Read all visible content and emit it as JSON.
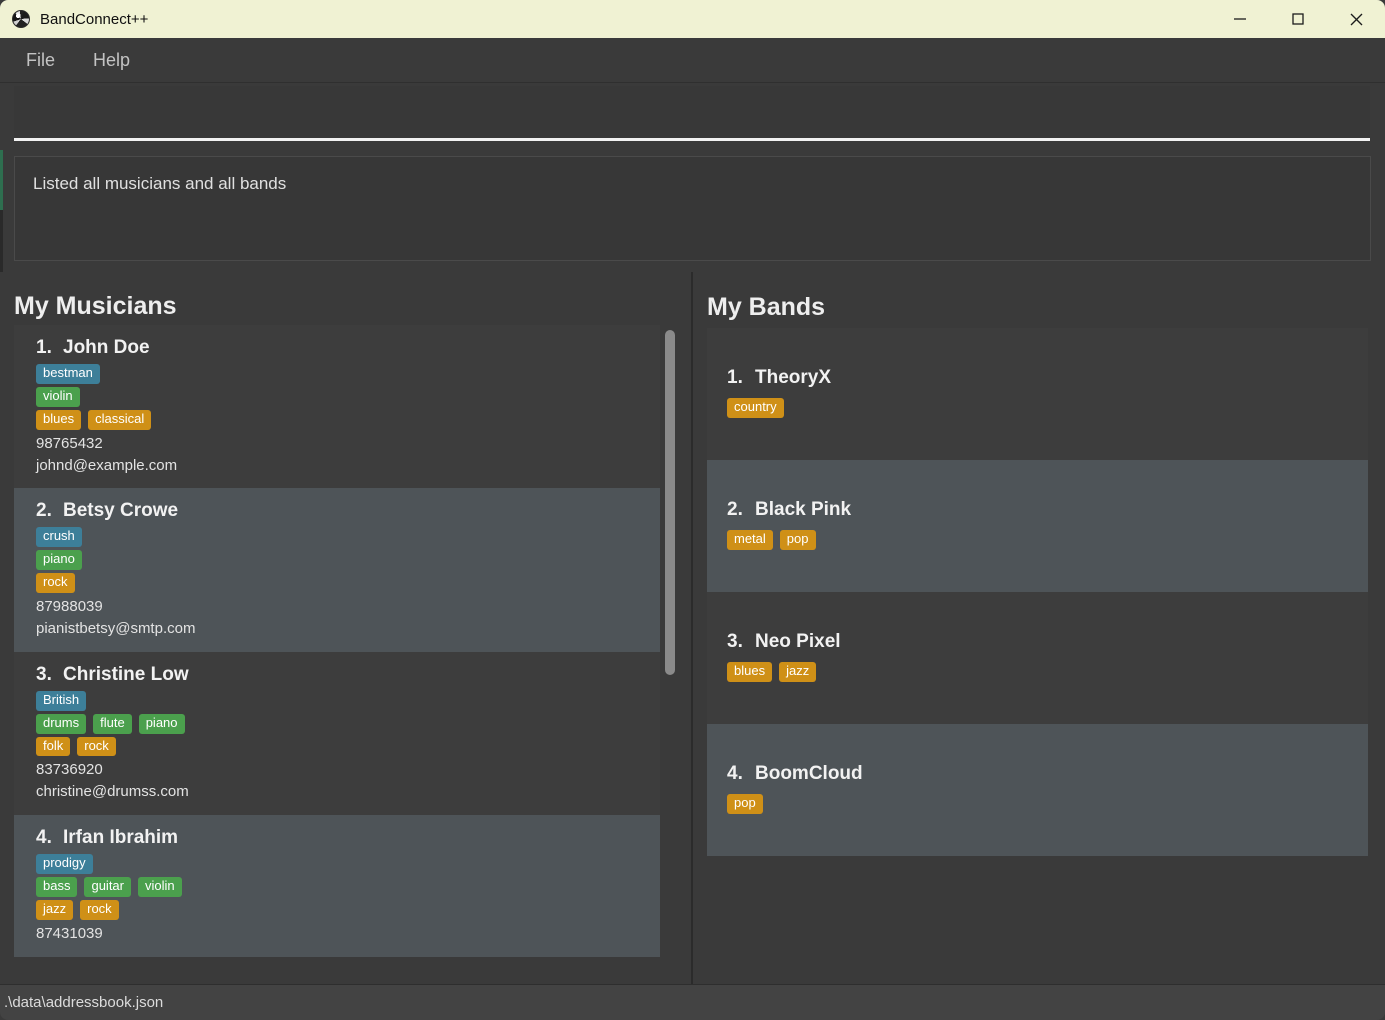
{
  "window": {
    "title": "BandConnect++",
    "icon": "app-ball-icon",
    "minimize_label": "–",
    "maximize_label": "□",
    "close_label": "✕"
  },
  "menu": {
    "items": [
      {
        "label": "File"
      },
      {
        "label": "Help"
      }
    ]
  },
  "command": {
    "value": "",
    "placeholder": ""
  },
  "result": {
    "text": "Listed all musicians and all bands"
  },
  "musicians_panel": {
    "title": "My Musicians",
    "items": [
      {
        "index": "1.",
        "name": "John Doe",
        "nicknames": [
          "bestman"
        ],
        "instruments": [
          "violin"
        ],
        "genres": [
          "blues",
          "classical"
        ],
        "phone": "98765432",
        "email": "johnd@example.com"
      },
      {
        "index": "2.",
        "name": "Betsy Crowe",
        "nicknames": [
          "crush"
        ],
        "instruments": [
          "piano"
        ],
        "genres": [
          "rock"
        ],
        "phone": "87988039",
        "email": "pianistbetsy@smtp.com"
      },
      {
        "index": "3.",
        "name": "Christine Low",
        "nicknames": [
          "British"
        ],
        "instruments": [
          "drums",
          "flute",
          "piano"
        ],
        "genres": [
          "folk",
          "rock"
        ],
        "phone": "83736920",
        "email": "christine@drumss.com"
      },
      {
        "index": "4.",
        "name": "Irfan Ibrahim",
        "nicknames": [
          "prodigy"
        ],
        "instruments": [
          "bass",
          "guitar",
          "violin"
        ],
        "genres": [
          "jazz",
          "rock"
        ],
        "phone": "87431039",
        "email": ""
      }
    ]
  },
  "bands_panel": {
    "title": "My Bands",
    "items": [
      {
        "index": "1.",
        "name": "TheoryX",
        "genres": [
          "country"
        ]
      },
      {
        "index": "2.",
        "name": "Black Pink",
        "genres": [
          "metal",
          "pop"
        ]
      },
      {
        "index": "3.",
        "name": "Neo Pixel",
        "genres": [
          "blues",
          "jazz"
        ]
      },
      {
        "index": "4.",
        "name": "BoomCloud",
        "genres": [
          "pop"
        ]
      }
    ]
  },
  "status_bar": {
    "text": ".\\data\\addressbook.json"
  },
  "colors": {
    "title_bar": "#f0f2d3",
    "window_bg": "#3a3a3a",
    "card_dark": "#3d3d3d",
    "card_light": "#4e5458",
    "tag_nickname": "#3d7f99",
    "tag_instrument": "#4ba04d",
    "tag_genre": "#cf9017",
    "command_underline": "#f2f2f2"
  }
}
